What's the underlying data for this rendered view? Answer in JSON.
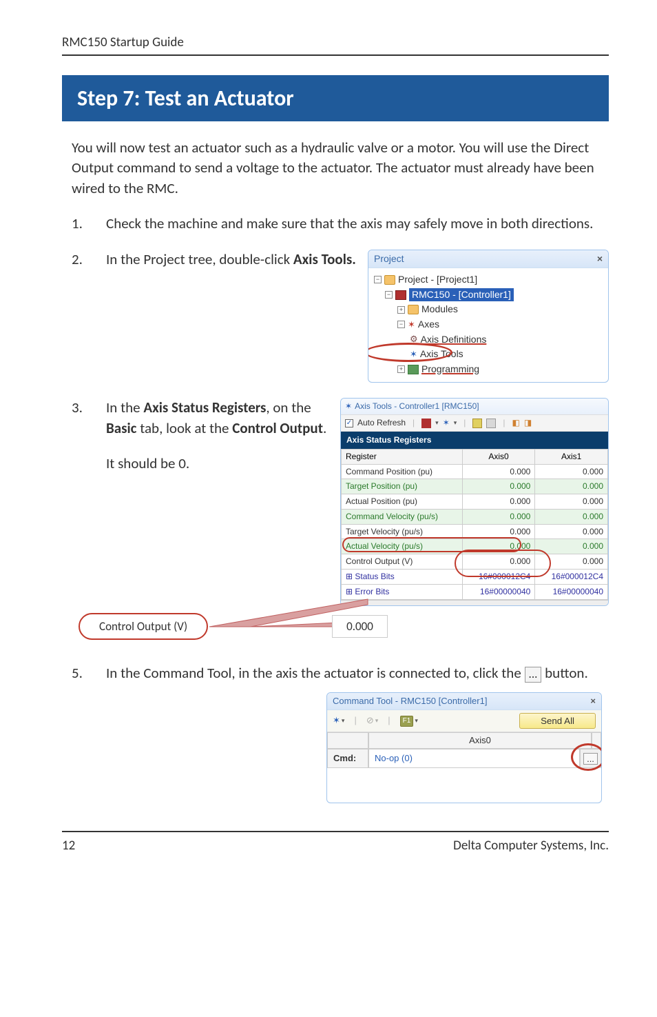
{
  "header": "RMC150 Startup Guide",
  "banner": "Step 7: Test an Actuator",
  "intro": "You will now test an actuator such as a hydraulic valve or a motor. You will use the Direct Output command to send a voltage to the actuator. The actuator must already have been wired to the RMC.",
  "steps": {
    "s1": {
      "num": "1.",
      "text": "Check the machine and make sure that the axis may safely move in both directions."
    },
    "s2": {
      "num": "2.",
      "text_a": "In the Project tree, double-click ",
      "text_b": "Axis Tools."
    },
    "s3": {
      "num": "3.",
      "text_a": "In the ",
      "text_b": "Axis Status Registers",
      "text_c": ", on the ",
      "text_d": "Basic",
      "text_e": " tab, look at the ",
      "text_f": "Control Output",
      "text_g": ".",
      "sub": "It should be 0."
    },
    "s5": {
      "num": "5.",
      "text_a": "In the Command Tool, in the axis the actuator is connected to, click the ",
      "text_b": " button."
    }
  },
  "project_panel": {
    "title": "Project",
    "root": "Project - [Project1]",
    "controller": "RMC150 - [Controller1]",
    "modules": "Modules",
    "axes": "Axes",
    "axis_defs": "Axis Definitions",
    "axis_tools": "Axis Tools",
    "programming": "Programming"
  },
  "axis_window": {
    "title": "Axis Tools - Controller1 [RMC150]",
    "auto_refresh": "Auto Refresh",
    "tab": "Axis Status Registers",
    "cols": {
      "reg": "Register",
      "a0": "Axis0",
      "a1": "Axis1"
    },
    "rows": [
      {
        "label": "Command Position (pu)",
        "a0": "0.000",
        "a1": "0.000",
        "shade": false
      },
      {
        "label": "Target Position (pu)",
        "a0": "0.000",
        "a1": "0.000",
        "shade": true
      },
      {
        "label": "Actual Position (pu)",
        "a0": "0.000",
        "a1": "0.000",
        "shade": false
      },
      {
        "label": "Command Velocity (pu/s)",
        "a0": "0.000",
        "a1": "0.000",
        "shade": true
      },
      {
        "label": "Target Velocity (pu/s)",
        "a0": "0.000",
        "a1": "0.000",
        "shade": false
      },
      {
        "label": "Actual Velocity (pu/s)",
        "a0": "0.000",
        "a1": "0.000",
        "shade": true
      },
      {
        "label": "Control Output (V)",
        "a0": "0.000",
        "a1": "0.000",
        "shade": false
      },
      {
        "label": "Status Bits",
        "a0": "16#000012C4",
        "a1": "16#000012C4",
        "shade": false,
        "hex": true
      },
      {
        "label": "Error Bits",
        "a0": "16#00000040",
        "a1": "16#00000040",
        "shade": false,
        "hex": true
      }
    ],
    "callout_label": "Control Output (V)",
    "callout_value": "0.000"
  },
  "cmd_window": {
    "title": "Command Tool - RMC150 [Controller1]",
    "send_all": "Send All",
    "axis_col": "Axis0",
    "cmd_label": "Cmd:",
    "cmd_value": "No-op (0)"
  },
  "footer": {
    "page": "12",
    "company": "Delta Computer Systems, Inc."
  }
}
